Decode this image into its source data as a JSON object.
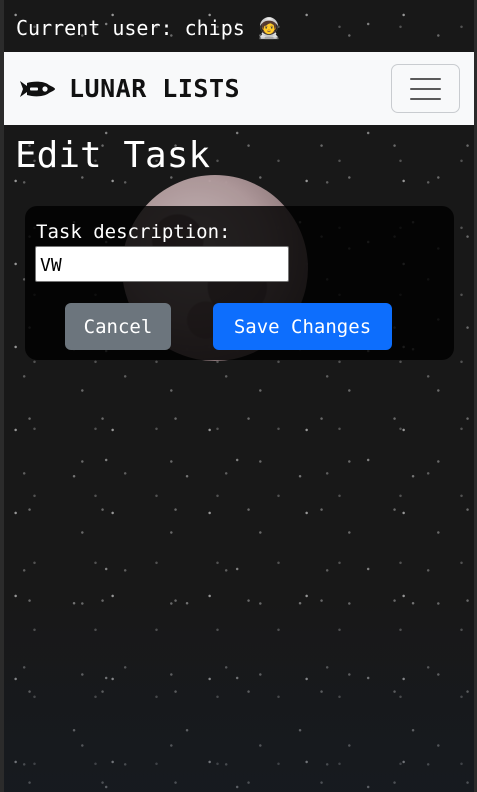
{
  "header": {
    "current_user_text": "Current user: chips 🧑‍🚀"
  },
  "navbar": {
    "brand_name": "LUNAR LISTS",
    "brand_icon": "rocket-icon",
    "menu_icon": "hamburger-menu-icon"
  },
  "main": {
    "page_title": "Edit Task",
    "form": {
      "label": "Task description:",
      "input_value": "VW",
      "cancel_label": "Cancel",
      "save_label": "Save Changes"
    }
  },
  "colors": {
    "navbar_bg": "#f8f9fa",
    "primary_button": "#0d6efd",
    "secondary_button": "#6c757d",
    "background": "#181818"
  }
}
